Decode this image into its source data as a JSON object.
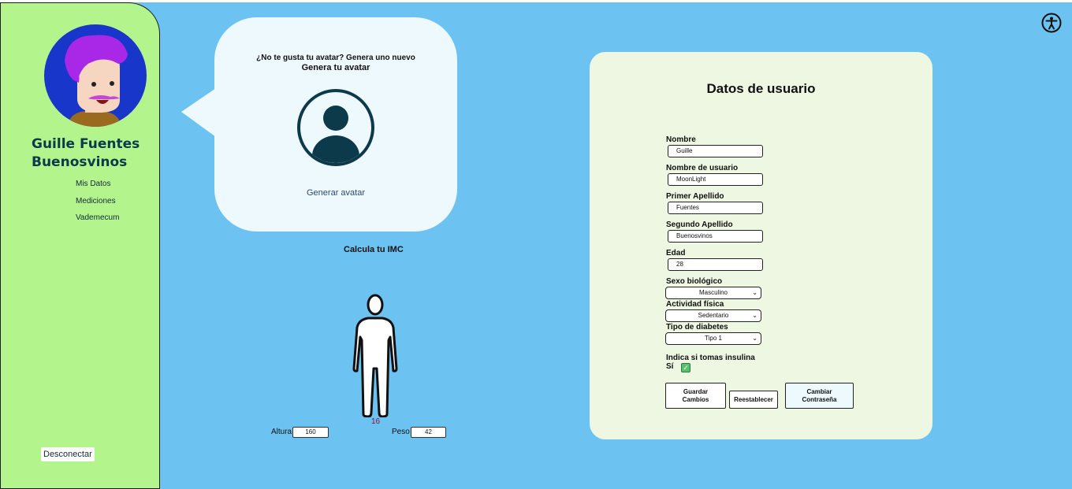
{
  "sidebar": {
    "user_name": "Guille Fuentes Buenosvinos",
    "nav": [
      "Mis Datos",
      "Mediciones",
      "Vademecum"
    ],
    "logout": "Desconectar"
  },
  "avatar_bubble": {
    "question": "¿No te gusta tu avatar? Genera uno nuevo",
    "heading": "Genera tu avatar",
    "link": "Generar avatar"
  },
  "imc": {
    "title": "Calcula tu IMC",
    "value": "16",
    "height_label": "Altura",
    "height_value": "160",
    "weight_label": "Peso",
    "weight_value": "42"
  },
  "form": {
    "title": "Datos de usuario",
    "fields": [
      {
        "label": "Nombre",
        "value": "Guille"
      },
      {
        "label": "Nombre de usuario",
        "value": "MoonLight"
      },
      {
        "label": "Primer Apellido",
        "value": "Fuentes"
      },
      {
        "label": "Segundo Apellido",
        "value": "Buenosvinos"
      },
      {
        "label": "Edad",
        "value": "28"
      }
    ],
    "selects": [
      {
        "label": "Sexo biológico",
        "value": "Masculino"
      },
      {
        "label": "Actividad física",
        "value": "Sedentario"
      },
      {
        "label": "Tipo de diabetes",
        "value": "Tipo 1"
      }
    ],
    "insulin_label": "Indica si tomas insulina",
    "insulin_option": "Sí",
    "insulin_checked": true,
    "buttons": {
      "save": "Guardar\nCambios",
      "reset": "Reestablecer",
      "change_password": "Cambiar\nContraseña"
    }
  },
  "colors": {
    "background": "#6cc3f1",
    "sidebar": "#b3f58c",
    "card": "#edf7e1",
    "bubble": "#eef9fd",
    "name_text": "#0b3a4a"
  },
  "icons": [
    "accessibility-icon",
    "user-profile-icon",
    "human-body-icon",
    "chevron-down-icon",
    "checkmark-icon"
  ]
}
